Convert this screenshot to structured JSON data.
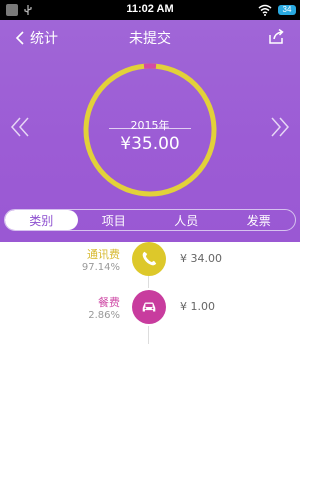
{
  "status_bar": {
    "time": "11:02 AM",
    "battery": "34",
    "icons": [
      "app-icon",
      "usb-icon",
      "wifi-icon",
      "battery-icon"
    ]
  },
  "nav": {
    "back_label": "统计",
    "title": "未提交",
    "share_icon": "share-icon"
  },
  "summary": {
    "year": "2015年",
    "amount": "¥35.00",
    "ring_color": "#e2d13a",
    "ring_segment_color": "#d34aa4"
  },
  "tabs": [
    {
      "label": "类别",
      "active": true
    },
    {
      "label": "项目",
      "active": false
    },
    {
      "label": "人员",
      "active": false
    },
    {
      "label": "发票",
      "active": false
    }
  ],
  "categories": [
    {
      "name": "通讯费",
      "percent": "97.14%",
      "amount": "¥ 34.00",
      "icon": "phone-icon",
      "color": "#ddc82a",
      "name_color": "#d7b92f"
    },
    {
      "name": "餐费",
      "percent": "2.86%",
      "amount": "¥ 1.00",
      "icon": "car-icon",
      "color": "#c83c9e",
      "name_color": "#cf4ca7"
    }
  ]
}
